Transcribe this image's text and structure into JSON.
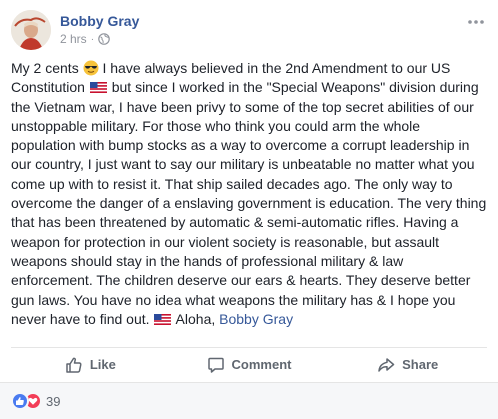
{
  "post": {
    "author": "Bobby Gray",
    "time": "2 hrs",
    "separator": "·",
    "more_icon": "ellipsis-icon",
    "body_segments": {
      "s1": "My 2 cents ",
      "s2": " I have always believed in the 2nd Amendment to our US Constitution ",
      "s3": " but since I worked in the \"Special Weapons\" division during the Vietnam war, I have been privy to some of the top secret abilities of our unstoppable military. For those who think you could arm the whole population with bump stocks as a way to overcome a corrupt leadership in our country, I just want to say our military is unbeatable no matter what you come up with to resist it. That ship sailed decades ago. The only way to overcome the danger of a enslaving government is education. The very thing that has been threatened by automatic & semi-automatic rifles. Having a weapon for protection in our violent society is reasonable, but assault weapons should stay in the hands of professional military & law enforcement. The children deserve our ears & hearts. They deserve better gun laws. You have no idea what weapons the military has & I hope you never have to find out. ",
      "s4": " Aloha, ",
      "mention": "Bobby Gray"
    }
  },
  "actions": {
    "like": "Like",
    "comment": "Comment",
    "share": "Share"
  },
  "reactions": {
    "count": "39",
    "types": [
      "like-reaction-icon",
      "love-reaction-icon"
    ]
  },
  "colors": {
    "link": "#365899",
    "meta": "#90949c",
    "action": "#606770",
    "like_reaction": "#4a7bf0",
    "love_reaction": "#f33e58"
  }
}
